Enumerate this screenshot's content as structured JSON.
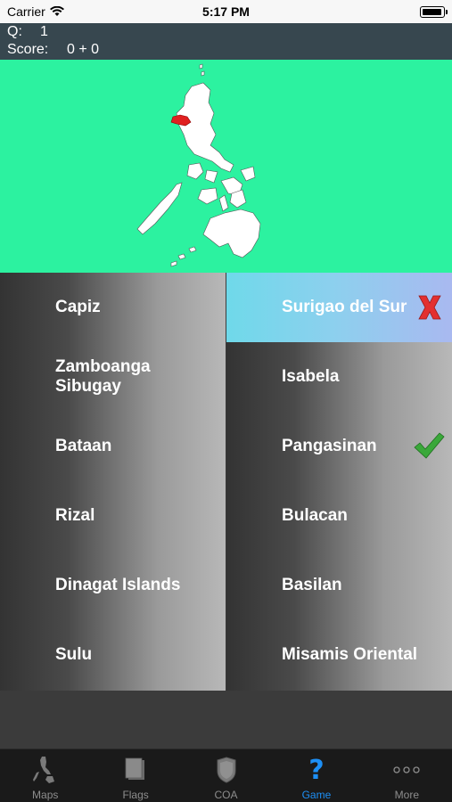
{
  "status": {
    "carrier": "Carrier",
    "time": "5:17 PM"
  },
  "header": {
    "q_label": "Q:",
    "q_value": "1",
    "score_label": "Score:",
    "score_value": "0 + 0"
  },
  "answers": {
    "left": [
      "Capiz",
      "Zamboanga Sibugay",
      "Bataan",
      "Rizal",
      "Dinagat Islands",
      "Sulu"
    ],
    "right": [
      "Surigao del Sur",
      "Isabela",
      "Pangasinan",
      "Bulacan",
      "Basilan",
      "Misamis Oriental"
    ]
  },
  "selected_answer": "Surigao del Sur",
  "selected_result": "wrong",
  "correct_answer": "Pangasinan",
  "tabs": [
    {
      "label": "Maps",
      "icon": "philippines-map-icon",
      "active": false
    },
    {
      "label": "Flags",
      "icon": "flag-icon",
      "active": false
    },
    {
      "label": "COA",
      "icon": "coat-of-arms-icon",
      "active": false
    },
    {
      "label": "Game",
      "icon": "question-mark-icon",
      "active": true
    },
    {
      "label": "More",
      "icon": "more-dots-icon",
      "active": false
    }
  ],
  "colors": {
    "map_background": "#2cf2a0",
    "highlight_region": "#e02020",
    "active_tab": "#1d8ff5",
    "wrong_mark": "#e33030",
    "correct_mark": "#3aa83a"
  }
}
